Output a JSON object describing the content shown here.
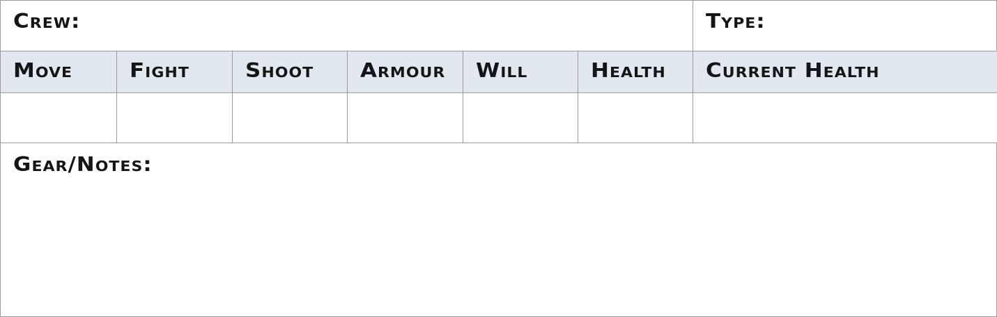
{
  "header": {
    "crew_label": "Crew:",
    "type_label": "Type:"
  },
  "stats": {
    "columns": [
      "Move",
      "Fight",
      "Shoot",
      "Armour",
      "Will",
      "Health",
      "Current Health"
    ],
    "values": [
      "",
      "",
      "",
      "",
      "",
      "",
      ""
    ]
  },
  "notes": {
    "label": "Gear/Notes:",
    "value": ""
  },
  "colors": {
    "header_fill": "#e1e8ef",
    "border": "#9a9a9a",
    "text": "#151515"
  }
}
